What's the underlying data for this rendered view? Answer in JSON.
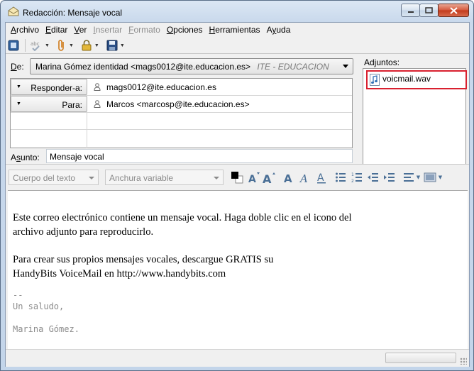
{
  "window": {
    "title": "Redacción: Mensaje vocal",
    "controls": {
      "minimize": "—",
      "maximize": "□",
      "close": "✕"
    }
  },
  "menu": [
    {
      "label": "Archivo",
      "key": "A",
      "rest": "rchivo",
      "disabled": false
    },
    {
      "label": "Editar",
      "key": "E",
      "rest": "ditar",
      "disabled": false
    },
    {
      "label": "Ver",
      "key": "V",
      "rest": "er",
      "disabled": false
    },
    {
      "label": "Insertar",
      "key": "I",
      "rest": "nsertar",
      "disabled": true
    },
    {
      "label": "Formato",
      "key": "F",
      "rest": "ormato",
      "disabled": true
    },
    {
      "label": "Opciones",
      "key": "O",
      "rest": "pciones",
      "disabled": false
    },
    {
      "label": "Herramientas",
      "key": "H",
      "rest": "erramientas",
      "disabled": false
    },
    {
      "label": "Ayuda",
      "key": "y",
      "pre": "A",
      "rest": "uda",
      "disabled": false
    }
  ],
  "header": {
    "from_label": "De:",
    "from_name": "Marina Gómez identidad <mags0012@ite.educacion.es>",
    "from_account": "ITE - EDUCACION",
    "recipients": [
      {
        "type": "Responder-a:",
        "value": "mags0012@ite.educacion.es"
      },
      {
        "type": "Para:",
        "value": "Marcos <marcosp@ite.educacion.es>"
      }
    ],
    "subject_label": "Asunto:",
    "subject_key": "s",
    "subject": "Mensaje vocal"
  },
  "attachments": {
    "label": "Adjuntos:",
    "items": [
      {
        "name": "voicmail.wav",
        "icon": "audio-file-icon"
      }
    ]
  },
  "format": {
    "paragraph_style": "Cuerpo del texto",
    "font": "Anchura variable"
  },
  "body": {
    "paragraph1_line1": "Este correo electrónico contiene un mensaje vocal. Haga doble clic en el icono del",
    "paragraph1_line2": "archivo adjunto para reproducirlo.",
    "paragraph2_line1": "Para crear sus propios mensajes vocales, descargue GRATIS su",
    "paragraph2_line2": "HandyBits VoiceMail en http://www.handybits.com",
    "sig_separator": "--",
    "sig_line1": "Un saludo,",
    "sig_line2": "Marina Gómez."
  },
  "colors": {
    "attachment_highlight": "#d9202f",
    "format_icon": "#4a6f96"
  }
}
